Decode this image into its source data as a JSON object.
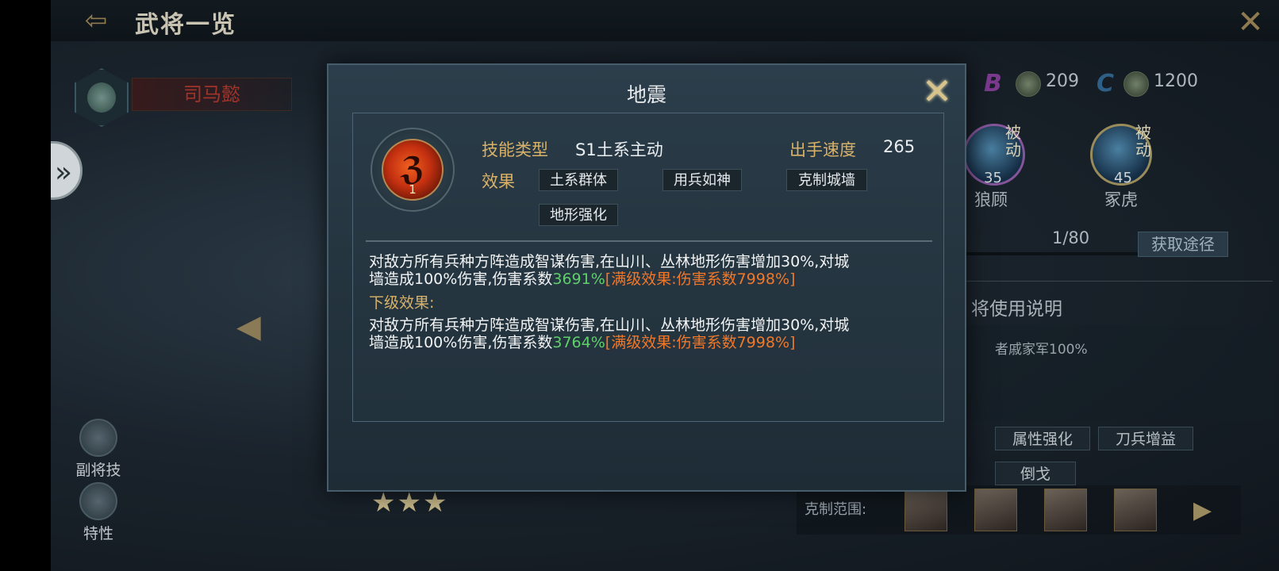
{
  "header": {
    "title": "武将一览"
  },
  "hero": {
    "name": "司马懿"
  },
  "stats": {
    "grade_b": "B",
    "grade_c": "C",
    "b_value": "209",
    "c_value": "1200"
  },
  "portraits": [
    {
      "passive": "被动",
      "level": "35",
      "name": "狼顾"
    },
    {
      "passive": "被动",
      "level": "45",
      "name": "冢虎"
    }
  ],
  "progress": {
    "text": "1/80",
    "button": "获取途径",
    "fill": 0.0125
  },
  "usage": {
    "title": "将使用说明",
    "text": "者戚家军100%"
  },
  "right_tags": [
    "属性强化",
    "刀兵增益",
    "倒戈"
  ],
  "counter": {
    "label": "克制范围:"
  },
  "left_menu": [
    {
      "label": "副将技"
    },
    {
      "label": "特性"
    }
  ],
  "stars": "★★★",
  "dialog": {
    "title": "地震",
    "skill_level": "1",
    "type_label": "技能类型",
    "type_value": "S1土系主动",
    "speed_label": "出手速度",
    "speed_value": "265",
    "effect_label": "效果",
    "effect_tags": [
      "土系群体",
      "用兵如神",
      "克制城墙",
      "地形强化"
    ],
    "desc1": {
      "line1": "对敌方所有兵种方阵造成智谋伤害,在山川、丛林地形伤害增加30%,对城",
      "line2a": "墙造成100%伤害,伤害系数",
      "coef": "3691%",
      "max": "[满级效果:伤害系数7998%]"
    },
    "next_label": "下级效果:",
    "desc2": {
      "line1": "对敌方所有兵种方阵造成智谋伤害,在山川、丛林地形伤害增加30%,对城",
      "line2a": "墙造成100%伤害,伤害系数",
      "coef": "3764%",
      "max": "[满级效果:伤害系数7998%]"
    }
  },
  "colors": {
    "accent_gold": "#d9b26a",
    "coef_green": "#5fd06a",
    "max_orange": "#f0782a"
  }
}
